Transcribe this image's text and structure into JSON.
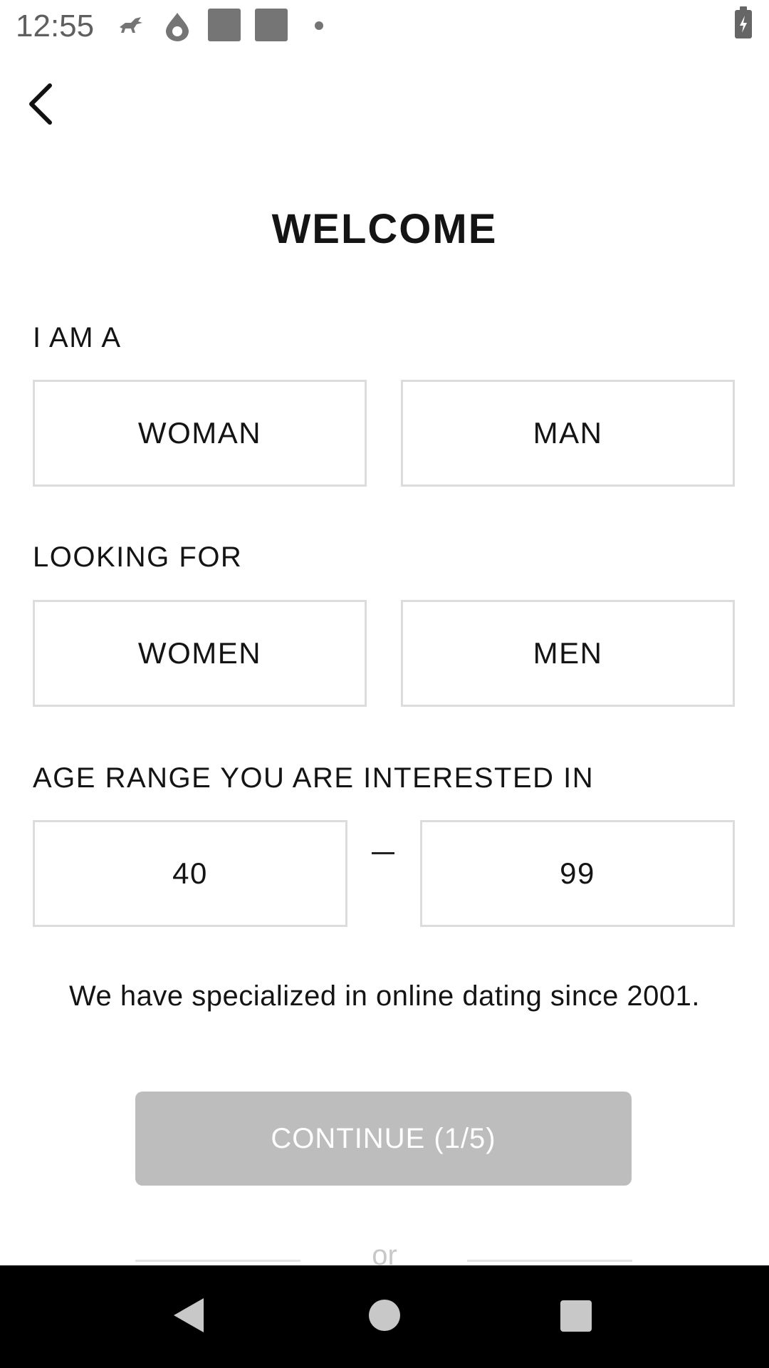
{
  "status_bar": {
    "time": "12:55",
    "icons": [
      "pegasus-icon",
      "drop-icon",
      "square-icon",
      "square-icon",
      "dot-icon",
      "battery-charging-icon"
    ]
  },
  "header": {
    "back_icon": "chevron-left-icon",
    "title": "WELCOME"
  },
  "i_am": {
    "label": "I AM A",
    "options": [
      "WOMAN",
      "MAN"
    ]
  },
  "looking_for": {
    "label": "LOOKING FOR",
    "options": [
      "WOMEN",
      "MEN"
    ]
  },
  "age_range": {
    "label": "AGE RANGE YOU ARE INTERESTED IN",
    "min": "40",
    "max": "99"
  },
  "info_text": "We have specialized in online dating since 2001.",
  "continue_button": "CONTINUE (1/5)",
  "divider_text": "or",
  "colors": {
    "disabled_button": "#bdbdbd",
    "option_border": "#dcdcdc",
    "nav_bar": "#000000"
  },
  "nav_bar": {
    "icons": [
      "back-triangle-icon",
      "home-circle-icon",
      "recents-square-icon"
    ]
  }
}
